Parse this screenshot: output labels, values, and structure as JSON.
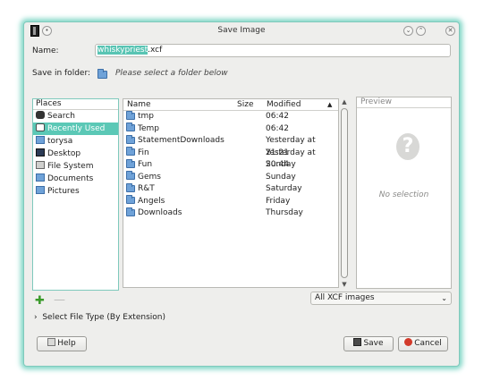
{
  "window": {
    "title": "Save Image"
  },
  "name_field": {
    "label": "Name:",
    "value_selected": "whiskypriest",
    "value_ext": ".xcf"
  },
  "save_in": {
    "label": "Save in folder:",
    "placeholder": "Please select a folder below"
  },
  "places": {
    "header": "Places",
    "items": [
      {
        "label": "Search",
        "icon": "binoculars-icon",
        "selected": false
      },
      {
        "label": "Recently Used",
        "icon": "clock-icon",
        "selected": true
      },
      {
        "label": "torysa",
        "icon": "home-folder-icon",
        "selected": false
      },
      {
        "label": "Desktop",
        "icon": "desktop-icon",
        "selected": false
      },
      {
        "label": "File System",
        "icon": "drive-icon",
        "selected": false
      },
      {
        "label": "Documents",
        "icon": "folder-icon",
        "selected": false
      },
      {
        "label": "Pictures",
        "icon": "folder-icon",
        "selected": false
      }
    ]
  },
  "files": {
    "columns": [
      "Name",
      "Size",
      "Modified"
    ],
    "rows": [
      {
        "name": "tmp",
        "modified": "06:42"
      },
      {
        "name": "Temp",
        "modified": "06:42"
      },
      {
        "name": "StatementDownloads",
        "modified": "Yesterday at 21:21"
      },
      {
        "name": "Fin",
        "modified": "Yesterday at 20:44"
      },
      {
        "name": "Fun",
        "modified": "Sunday"
      },
      {
        "name": "Gems",
        "modified": "Sunday"
      },
      {
        "name": "R&T",
        "modified": "Saturday"
      },
      {
        "name": "Angels",
        "modified": "Friday"
      },
      {
        "name": "Downloads",
        "modified": "Thursday"
      }
    ]
  },
  "preview": {
    "header": "Preview",
    "empty_text": "No selection"
  },
  "filter": {
    "value": "All XCF images"
  },
  "file_type": {
    "label": "Select File Type (By Extension)"
  },
  "buttons": {
    "help": "Help",
    "save": "Save",
    "cancel": "Cancel"
  },
  "colors": {
    "accent": "#5bc8b6",
    "glow": "#7fd6c6"
  }
}
